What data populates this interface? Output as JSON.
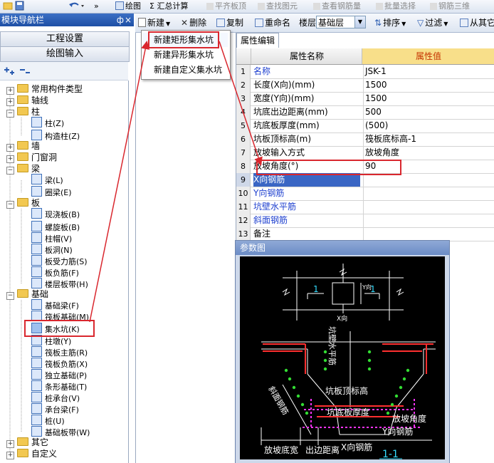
{
  "toolbar_top": {
    "draw_label": "绘图",
    "sum_label": "Σ 汇总计算",
    "align_label": "平齐板顶",
    "find_label": "查找图元",
    "view_rebar_label": "查看钢筋量",
    "batch_select_label": "批量选择",
    "rebar_3d_label": "钢筋三维",
    "overflow": "»"
  },
  "nav_panel": {
    "title": "模块导航栏",
    "pin": "ф",
    "close": "×",
    "project_settings": "工程设置",
    "drawing_input": "绘图输入"
  },
  "tree": {
    "items": [
      {
        "label": "常用构件类型",
        "type": "folder",
        "exp": "+"
      },
      {
        "label": "轴线",
        "type": "folder",
        "exp": "+"
      },
      {
        "label": "柱",
        "type": "folder",
        "exp": "−"
      },
      {
        "label": "柱(Z)",
        "type": "leaf"
      },
      {
        "label": "构造柱(Z)",
        "type": "leaf"
      },
      {
        "label": "墙",
        "type": "folder",
        "exp": "+"
      },
      {
        "label": "门窗洞",
        "type": "folder",
        "exp": "+"
      },
      {
        "label": "梁",
        "type": "folder",
        "exp": "−"
      },
      {
        "label": "梁(L)",
        "type": "leaf"
      },
      {
        "label": "圈梁(E)",
        "type": "leaf"
      },
      {
        "label": "板",
        "type": "folder",
        "exp": "−"
      },
      {
        "label": "现浇板(B)",
        "type": "leaf"
      },
      {
        "label": "螺旋板(B)",
        "type": "leaf"
      },
      {
        "label": "柱帽(V)",
        "type": "leaf"
      },
      {
        "label": "板洞(N)",
        "type": "leaf"
      },
      {
        "label": "板受力筋(S)",
        "type": "leaf"
      },
      {
        "label": "板负筋(F)",
        "type": "leaf"
      },
      {
        "label": "楼层板带(H)",
        "type": "leaf"
      },
      {
        "label": "基础",
        "type": "folder",
        "exp": "−"
      },
      {
        "label": "基础梁(F)",
        "type": "leaf"
      },
      {
        "label": "筏板基础(M)",
        "type": "leaf"
      },
      {
        "label": "集水坑(K)",
        "type": "leaf"
      },
      {
        "label": "柱墩(Y)",
        "type": "leaf"
      },
      {
        "label": "筏板主筋(R)",
        "type": "leaf"
      },
      {
        "label": "筏板负筋(X)",
        "type": "leaf"
      },
      {
        "label": "独立基础(P)",
        "type": "leaf"
      },
      {
        "label": "条形基础(T)",
        "type": "leaf"
      },
      {
        "label": "桩承台(V)",
        "type": "leaf"
      },
      {
        "label": "承台梁(F)",
        "type": "leaf"
      },
      {
        "label": "桩(U)",
        "type": "leaf"
      },
      {
        "label": "基础板带(W)",
        "type": "leaf"
      },
      {
        "label": "其它",
        "type": "folder",
        "exp": "+"
      },
      {
        "label": "自定义",
        "type": "folder",
        "exp": "+"
      }
    ]
  },
  "toolbar2": {
    "new_label": "新建",
    "delete_label": "删除",
    "copy_label": "复制",
    "rename_label": "重命名",
    "floor_label": "楼层",
    "floor_value": "基础层",
    "sort_label": "排序",
    "filter_label": "过滤",
    "import_label": "从其它"
  },
  "new_menu": {
    "items": [
      "新建矩形集水坑",
      "新建异形集水坑",
      "新建自定义集水坑"
    ]
  },
  "props": {
    "tab_label": "属性编辑",
    "header_name": "属性名称",
    "header_value": "属性值",
    "rows": [
      {
        "n": "1",
        "name": "名称",
        "value": "JSK-1",
        "blue": true
      },
      {
        "n": "2",
        "name": "长度(X向)(mm)",
        "value": "1500",
        "blue": false
      },
      {
        "n": "3",
        "name": "宽度(Y向)(mm)",
        "value": "1500",
        "blue": false
      },
      {
        "n": "4",
        "name": "坑底出边距离(mm)",
        "value": "500",
        "blue": false
      },
      {
        "n": "5",
        "name": "坑底板厚度(mm)",
        "value": "(500)",
        "blue": false
      },
      {
        "n": "6",
        "name": "坑板顶标高(m)",
        "value": "筏板底标高-1",
        "blue": false
      },
      {
        "n": "7",
        "name": "放坡输入方式",
        "value": "放坡角度",
        "blue": false
      },
      {
        "n": "8",
        "name": "放坡角度(°)",
        "value": "90",
        "blue": false
      },
      {
        "n": "9",
        "name": "X向钢筋",
        "value": "",
        "blue": true
      },
      {
        "n": "10",
        "name": "Y向钢筋",
        "value": "",
        "blue": true
      },
      {
        "n": "11",
        "name": "坑壁水平筋",
        "value": "",
        "blue": true
      },
      {
        "n": "12",
        "name": "斜面钢筋",
        "value": "",
        "blue": true
      },
      {
        "n": "13",
        "name": "备注",
        "value": "",
        "blue": false
      }
    ]
  },
  "param_window": {
    "title": "参数图",
    "labels": {
      "plan_1_left": "1",
      "plan_1_right": "1",
      "x_dir": "X向",
      "y_dir": "Y向",
      "wall_horizontal": "坑壁水平筋",
      "slope_rebar": "斜面钢筋",
      "top_elev": "坑板顶标高",
      "bottom_thick": "坑底板厚度",
      "slope_angle": "放坡角度",
      "y_rebar": "Y向钢筋",
      "slope_width": "放坡底宽",
      "edge_dist": "出边距离",
      "x_rebar": "X向钢筋",
      "section": "1-1"
    }
  },
  "colors": {
    "highlight": "#d9272e",
    "selection_blue": "#3a66c4",
    "header_yellow": "#f8df8a",
    "diagram_bg": "#000000",
    "rebar_magenta": "#ff33ff",
    "rebar_green": "#33dd33"
  }
}
